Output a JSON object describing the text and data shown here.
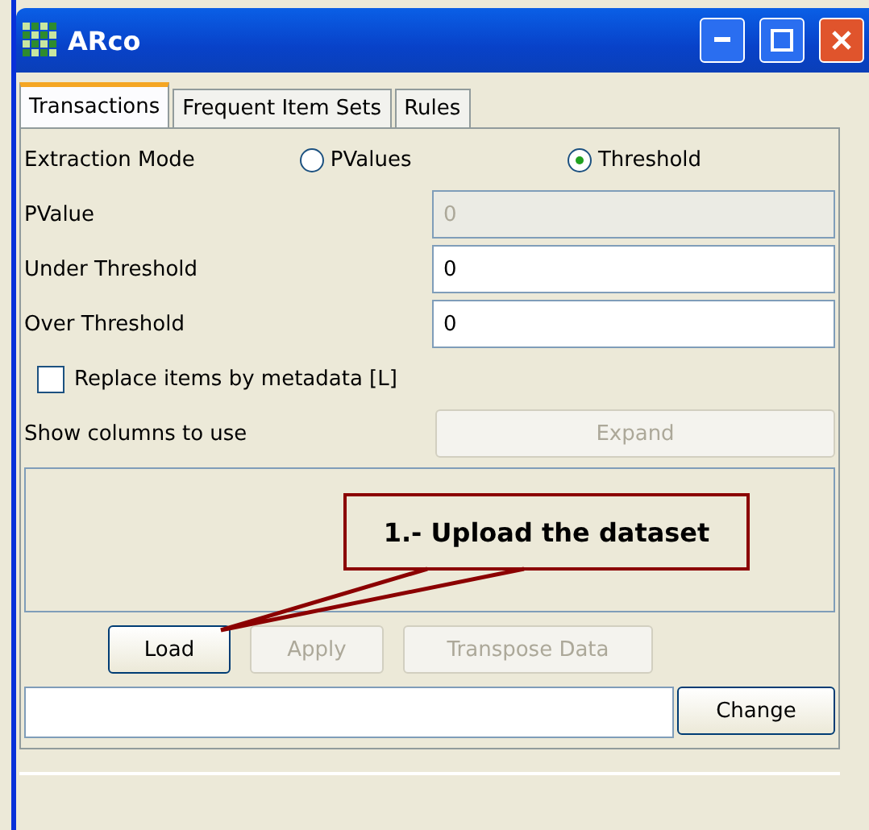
{
  "window": {
    "title": "ARco"
  },
  "tabs": [
    {
      "label": "Transactions",
      "selected": true
    },
    {
      "label": "Frequent Item Sets",
      "selected": false
    },
    {
      "label": "Rules",
      "selected": false
    }
  ],
  "extraction_mode": {
    "label": "Extraction Mode",
    "options": [
      {
        "label": "PValues",
        "selected": false
      },
      {
        "label": "Threshold",
        "selected": true
      }
    ]
  },
  "fields": [
    {
      "label": "PValue",
      "value": "0",
      "disabled": true
    },
    {
      "label": "Under Threshold",
      "value": "0",
      "disabled": false
    },
    {
      "label": "Over Threshold",
      "value": "0",
      "disabled": false
    }
  ],
  "metadata_checkbox": {
    "label": "Replace items by metadata [L]",
    "checked": false
  },
  "columns": {
    "label": "Show columns to use",
    "button": {
      "label": "Expand",
      "disabled": true
    }
  },
  "actions": [
    {
      "label": "Load",
      "disabled": false
    },
    {
      "label": "Apply",
      "disabled": true
    },
    {
      "label": "Transpose Data",
      "disabled": true
    }
  ],
  "change_button": {
    "label": "Change"
  },
  "callout": {
    "text": "1.- Upload the dataset"
  }
}
